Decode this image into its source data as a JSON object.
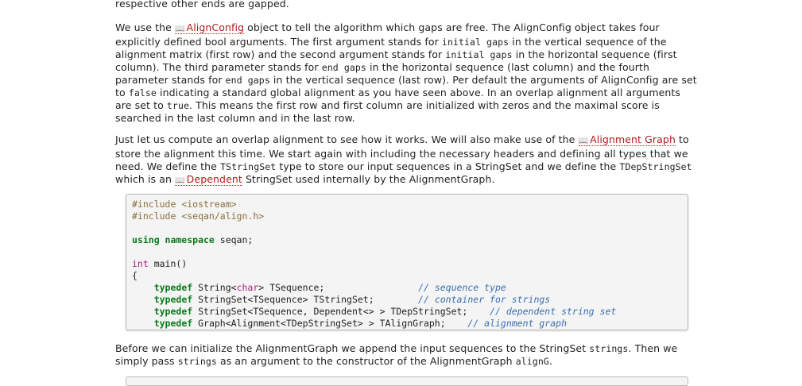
{
  "para0": "respective other ends are gapped.",
  "para1": {
    "t1": "We use the ",
    "link_alignconfig": "AlignConfig",
    "t2": " object to tell the algorithm which gaps are free. The AlignConfig object takes four explicitly defined bool arguments. The first argument stands for ",
    "c_initial1": "initial gaps",
    "t3": " in the vertical sequence of the alignment matrix (first row) and the second argument stands for ",
    "c_initial2": "initial gaps",
    "t4": " in the horizontal sequence (first column). The third parameter stands for ",
    "c_end1": "end gaps",
    "t5": " in the horizontal sequence (last column) and the fourth parameter stands for ",
    "c_end2": "end gaps",
    "t6": " in the vertical sequence (last row). Per default the arguments of AlignConfig are set to ",
    "c_false": "false",
    "t7": " indicating a standard global alignment as you have seen above. In an overlap alignment all arguments are set to ",
    "c_true": "true",
    "t8": ". This means the first row and first column are initialized with zeros and the maximal score is searched in the last column and in the last row."
  },
  "para2": {
    "t1": "Just let us compute an overlap alignment to see how it works. We will also make use of the ",
    "link_alignmentgraph": "Alignment Graph",
    "t2": " to store the alignment this time. We start again with including the necessary headers and defining all types that we need. We define the ",
    "c_tstringset": "TStringSet",
    "t3": " type to store our input sequences in a StringSet and we define the ",
    "c_tdepstringset": "TDepStringSet",
    "t4": " which is an ",
    "link_dependent": "Dependent",
    "t5": " StringSet used internally by the AlignmentGraph."
  },
  "code": {
    "inc1_kw": "#include",
    "inc1_arg": " <iostream>",
    "inc2_kw": "#include",
    "inc2_arg": " <seqan/align.h>",
    "using_kw": "using namespace",
    "using_rest": " seqan;",
    "int_kw": "int",
    "main_rest": " main()",
    "brace_open": "{",
    "l1_kw": "typedef",
    "l1_a": " String<",
    "l1_ty": "char",
    "l1_b": "> TSequence;",
    "l1_pad": "                 ",
    "l1_cm": "// sequence type",
    "l2_kw": "typedef",
    "l2_a": " StringSet<TSequence> TStringSet;",
    "l2_pad": "        ",
    "l2_cm": "// container for strings",
    "l3_kw": "typedef",
    "l3_a": " StringSet<TSequence, Dependent<> > TDepStringSet;",
    "l3_pad": "    ",
    "l3_cm": "// dependent string set",
    "l4_kw": "typedef",
    "l4_a": " Graph<Alignment<TDepStringSet> > TAlignGraph;",
    "l4_pad": "    ",
    "l4_cm": "// alignment graph"
  },
  "para3": {
    "t1": "Before we can initialize the AlignmentGraph we append the input sequences to the StringSet ",
    "c_strings1": "strings",
    "t2": ". Then we simply pass ",
    "c_strings2": "strings",
    "t3": " as an argument to the constructor of the AlignmentGraph ",
    "c_aligng": "alignG",
    "t4": "."
  },
  "icons": {
    "doc_link": "book-icon"
  },
  "colors": {
    "link": "#b01a1a",
    "keyword": "#0a7a1a",
    "comment": "#3a6fb0",
    "type": "#aa2277",
    "preproc": "#8a6d3b"
  }
}
